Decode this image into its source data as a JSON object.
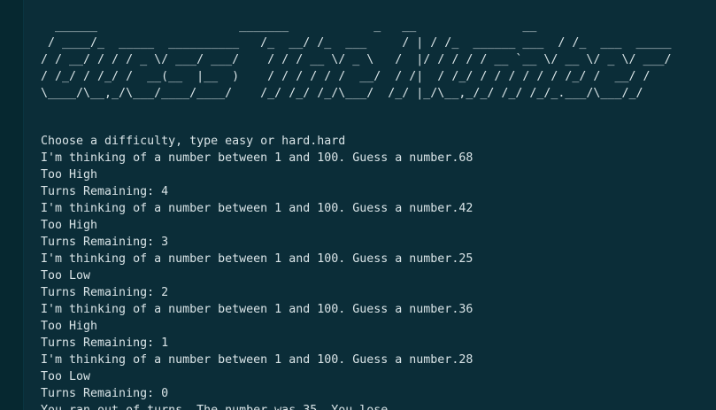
{
  "terminal": {
    "banner": "  ______                    _______            _   __               __\n / ____/_  _____  __________   /_  __/ /_  ___     / | / /_  ______ ___  / /_  ___  _____\n/ / __/ / / / _ \\/ ___/ ___/    / / / __ \\/ _ \\   /  |/ / / / / __ `__ \\/ __ \\/ _ \\/ ___/\n/ /_/ / /_/ /  __(__  |__  )    / / / / / /  __/  / /|  / /_/ / / / / / / /_/ /  __/ /\n\\____/\\__,_/\\___/____/____/    /_/ /_/ /_/\\___/  /_/ |_/\\__,_/_/ /_/ /_/_.___/\\___/_/",
    "lines": [
      "Choose a difficulty, type easy or hard.hard",
      "I'm thinking of a number between 1 and 100. Guess a number.68",
      "Too High",
      "Turns Remaining: 4",
      "I'm thinking of a number between 1 and 100. Guess a number.42",
      "Too High",
      "Turns Remaining: 3",
      "I'm thinking of a number between 1 and 100. Guess a number.25",
      "Too Low",
      "Turns Remaining: 2",
      "I'm thinking of a number between 1 and 100. Guess a number.36",
      "Too High",
      "Turns Remaining: 1",
      "I'm thinking of a number between 1 and 100. Guess a number.28",
      "Too Low",
      "Turns Remaining: 0",
      "You ran out of turns. The number was 35. You lose."
    ]
  },
  "colors": {
    "background": "#0b2d38",
    "gutter": "#062830",
    "text": "#d9e4e7"
  }
}
